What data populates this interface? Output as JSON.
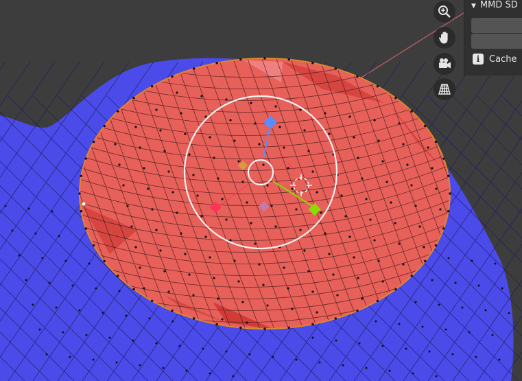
{
  "viewport": {
    "background": "#3d3d3d",
    "mesh_colors": {
      "base_mesh": "#4b4bea",
      "selected_faces": "#e8605a",
      "selected_edges": "#e0872a",
      "vertex_dots": "#111111"
    },
    "gizmo": {
      "icons": [
        "circle-icon",
        "z-axis-handle-icon",
        "x-axis-handle-icon",
        "y-axis-handle-icon",
        "pivot-cursor-icon"
      ],
      "colors": {
        "x": "#ff3352",
        "y": "#8bdc00",
        "z": "#5a8cff",
        "ring": "#f2f2f2",
        "plane": "#d89a3a"
      }
    }
  },
  "navigation": {
    "buttons": [
      {
        "name": "zoom",
        "icon": "magnifier-plus-icon"
      },
      {
        "name": "pan",
        "icon": "hand-icon"
      },
      {
        "name": "camera",
        "icon": "camera-icon"
      },
      {
        "name": "perspective",
        "icon": "grid-perspective-icon"
      }
    ]
  },
  "side_panel": {
    "header": "MMD SD",
    "cache_label": "Cache",
    "info_glyph": "i"
  }
}
